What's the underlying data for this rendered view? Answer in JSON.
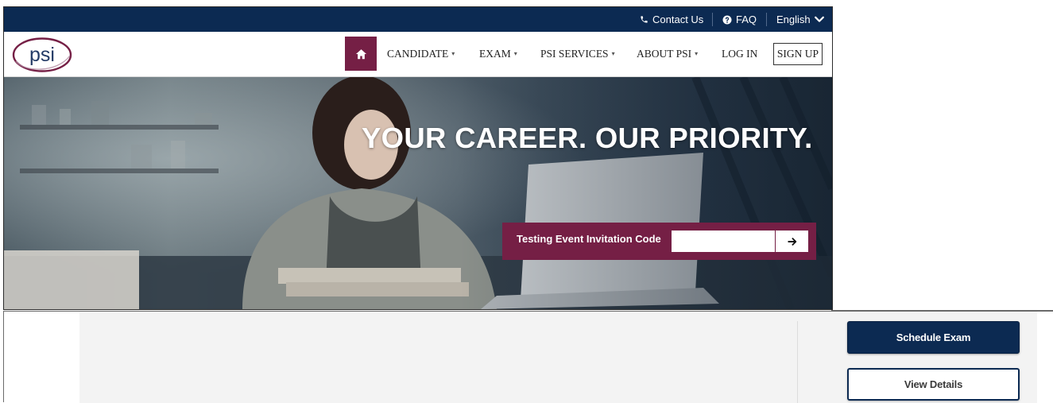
{
  "utility_bar": {
    "contact_label": "Contact Us",
    "faq_label": "FAQ",
    "language_label": "English"
  },
  "brand": {
    "logo_text": "psi"
  },
  "nav": {
    "items": [
      {
        "label": "CANDIDATE",
        "has_dropdown": true
      },
      {
        "label": "EXAM",
        "has_dropdown": true
      },
      {
        "label": "PSI SERVICES",
        "has_dropdown": true
      },
      {
        "label": "ABOUT PSI",
        "has_dropdown": true
      },
      {
        "label": "LOG IN",
        "has_dropdown": false
      }
    ],
    "signup_label": "SIGN UP"
  },
  "hero": {
    "headline": "YOUR CAREER. OUR PRIORITY.",
    "code_label": "Testing Event Invitation Code",
    "code_value": "",
    "code_placeholder": ""
  },
  "actions": {
    "schedule_label": "Schedule Exam",
    "details_label": "View Details"
  },
  "colors": {
    "navy": "#0c2a52",
    "maroon": "#751f45"
  },
  "icons": [
    "phone-icon",
    "question-circle-icon",
    "chevron-down-icon",
    "home-icon",
    "arrow-right-icon"
  ]
}
